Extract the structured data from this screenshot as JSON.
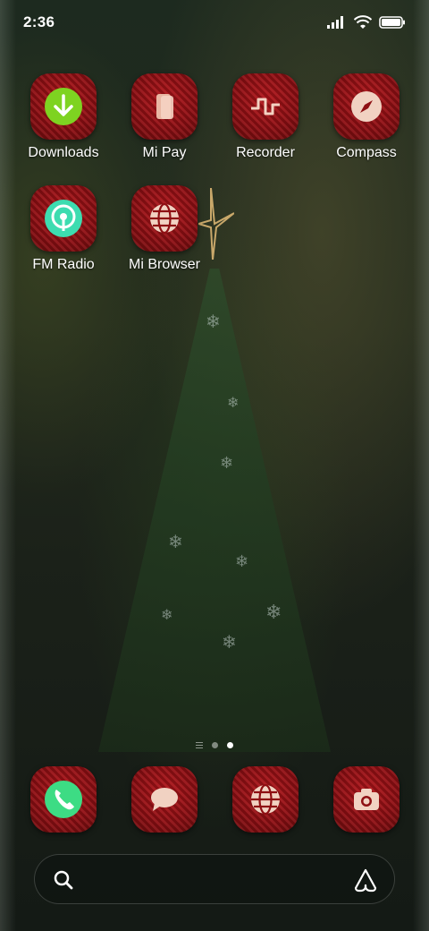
{
  "status_bar": {
    "time": "2:36",
    "icons": [
      "signal-icon",
      "wifi-icon",
      "battery-icon"
    ]
  },
  "apps": [
    {
      "label": "Downloads",
      "icon": "download-icon"
    },
    {
      "label": "Mi Pay",
      "icon": "card-icon"
    },
    {
      "label": "Recorder",
      "icon": "waveform-icon"
    },
    {
      "label": "Compass",
      "icon": "compass-icon"
    },
    {
      "label": "FM Radio",
      "icon": "radio-icon"
    },
    {
      "label": "Mi Browser",
      "icon": "globe-icon"
    }
  ],
  "page_indicator": {
    "pages": 2,
    "current": 2
  },
  "dock": [
    {
      "icon": "phone-icon"
    },
    {
      "icon": "chat-icon"
    },
    {
      "icon": "globe-icon"
    },
    {
      "icon": "camera-icon"
    }
  ],
  "search": {
    "icon": "search-icon",
    "assistant_icon": "assistant-icon"
  },
  "colors": {
    "icon_red": "#a81216",
    "accent_green": "#3ddc84",
    "accent_lime": "#7ed321"
  }
}
